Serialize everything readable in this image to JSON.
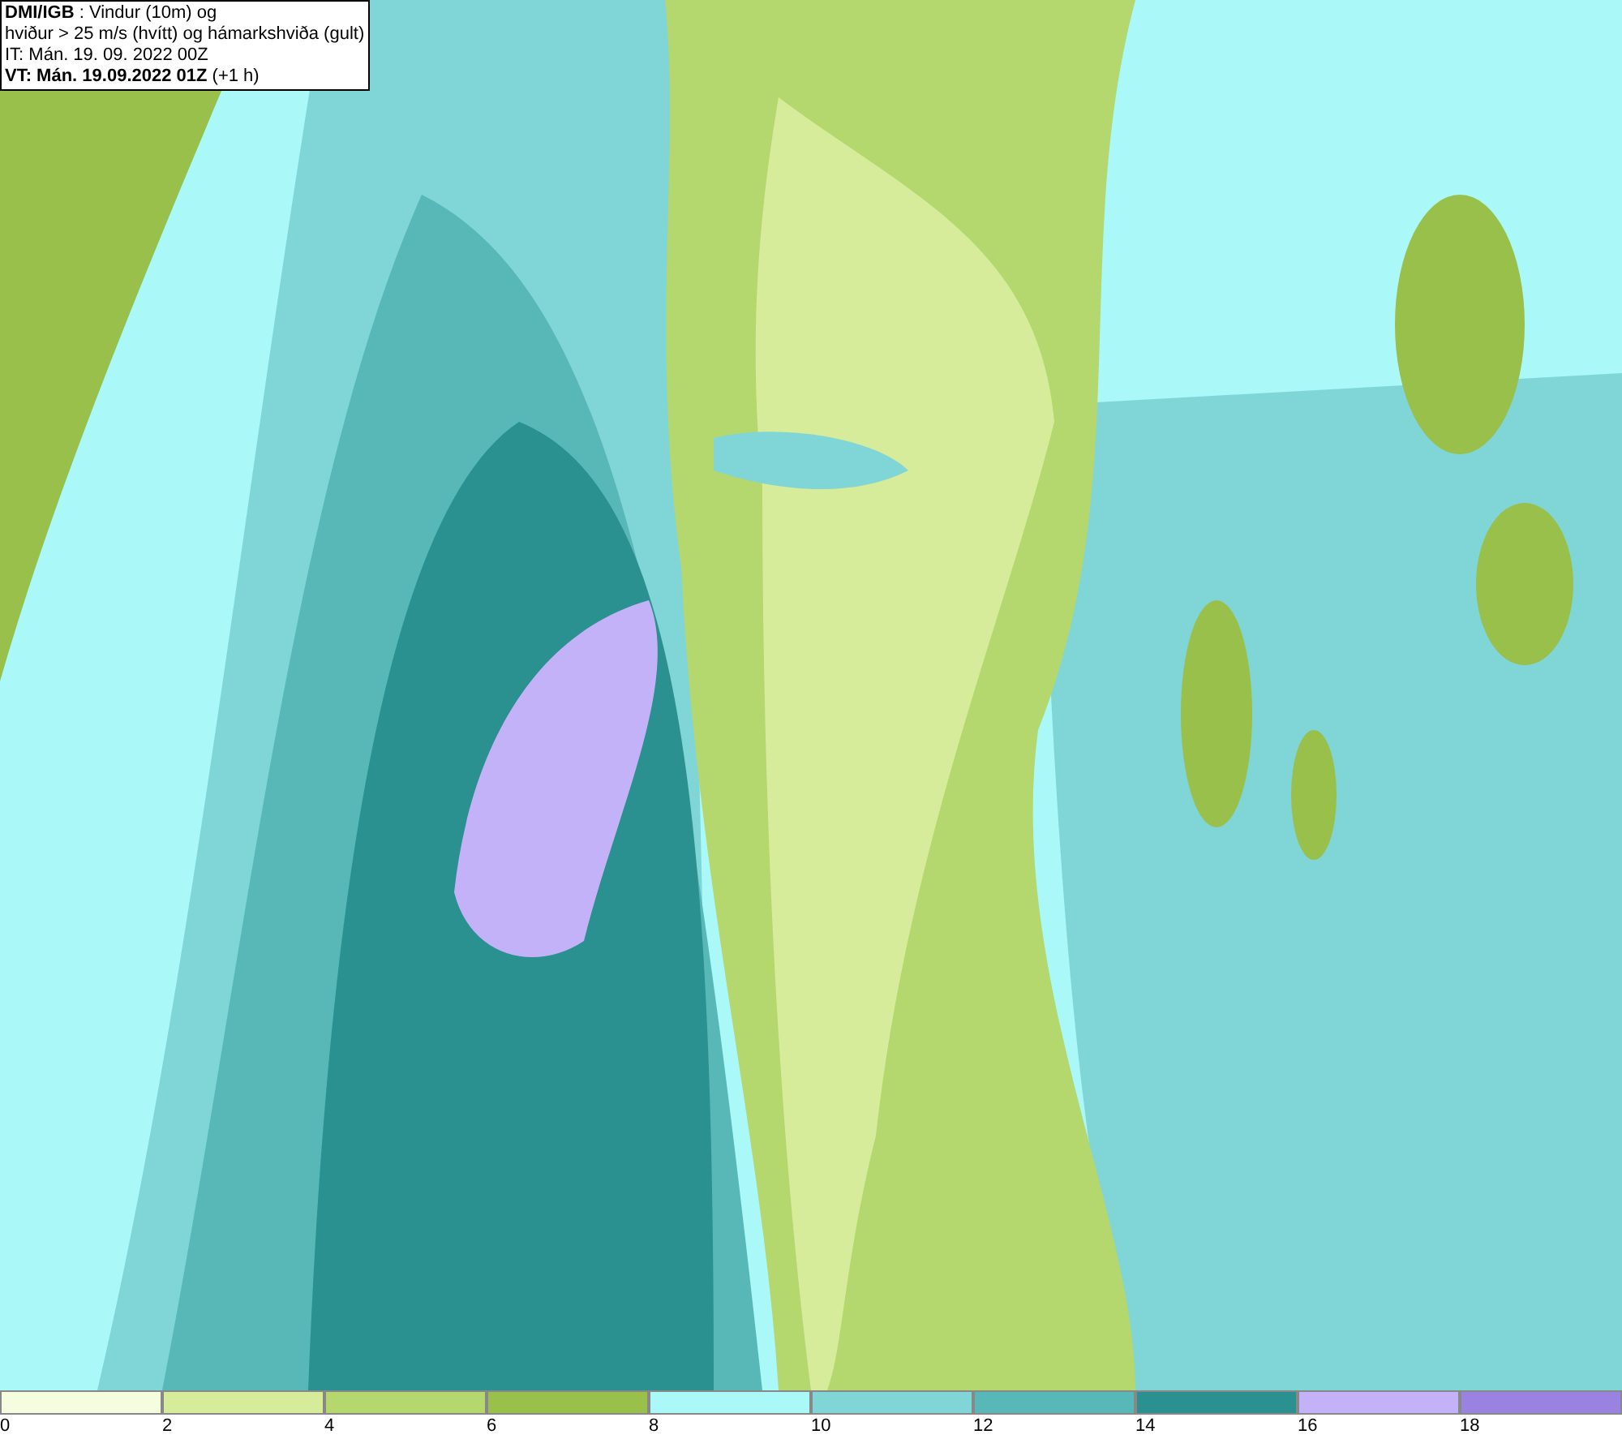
{
  "header": {
    "lines": [
      "**DMI/IGB** : Vindur (10m) og",
      "hviður > 25 m/s (hvítt) og hámarkshviða (gult)",
      "IT: Mán. 19. 09. 2022 00Z",
      "**VT: Mán. 19.09.2022 01Z** (+1 h)"
    ]
  },
  "legend": {
    "bins": [
      {
        "color": "#f5fddf",
        "tick": "0"
      },
      {
        "color": "#d7ec9a",
        "tick": "2"
      },
      {
        "color": "#b4d76e",
        "tick": "4"
      },
      {
        "color": "#98c04a",
        "tick": "6"
      },
      {
        "color": "#aaf8f8",
        "tick": "8"
      },
      {
        "color": "#80d6d6",
        "tick": "10"
      },
      {
        "color": "#58b8b8",
        "tick": "12"
      },
      {
        "color": "#2a9090",
        "tick": "14"
      },
      {
        "color": "#c4b2f8",
        "tick": "16"
      },
      {
        "color": "#9a82e0",
        "tick": "18"
      }
    ]
  }
}
